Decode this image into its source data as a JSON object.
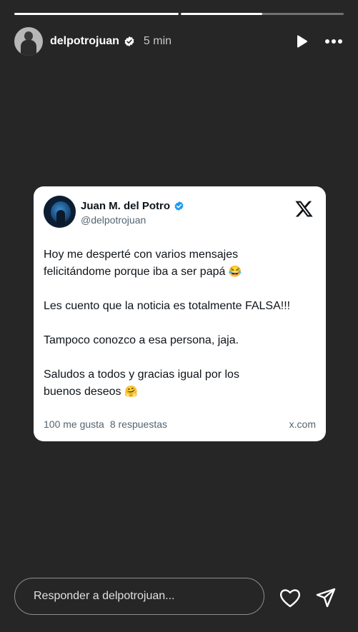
{
  "story": {
    "username": "delpotrojuan",
    "time_ago": "5 min",
    "progress": [
      1.0,
      0.5
    ]
  },
  "tweet": {
    "display_name": "Juan M. del Potro",
    "handle": "@delpotrojuan",
    "paragraphs": [
      "Hoy me desperté con varios mensajes\nfelicitándome porque iba a ser papá",
      "Les cuento que la noticia es totalmente FALSA!!!",
      "Tampoco conozco a esa persona, jaja.",
      "Saludos a todos y gracias igual por los\nbuenos deseos"
    ],
    "emojis": [
      "😂",
      "🤗"
    ],
    "likes": "100 me gusta",
    "replies": "8 respuestas",
    "domain": "x.com"
  },
  "reply": {
    "placeholder": "Responder a delpotrojuan..."
  },
  "colors": {
    "background": "#262626",
    "verified": "#1d9bf0",
    "card": "#ffffff"
  },
  "icons": [
    "verified-badge-icon",
    "play-icon",
    "more-icon",
    "x-logo-icon",
    "heart-icon",
    "send-icon"
  ]
}
